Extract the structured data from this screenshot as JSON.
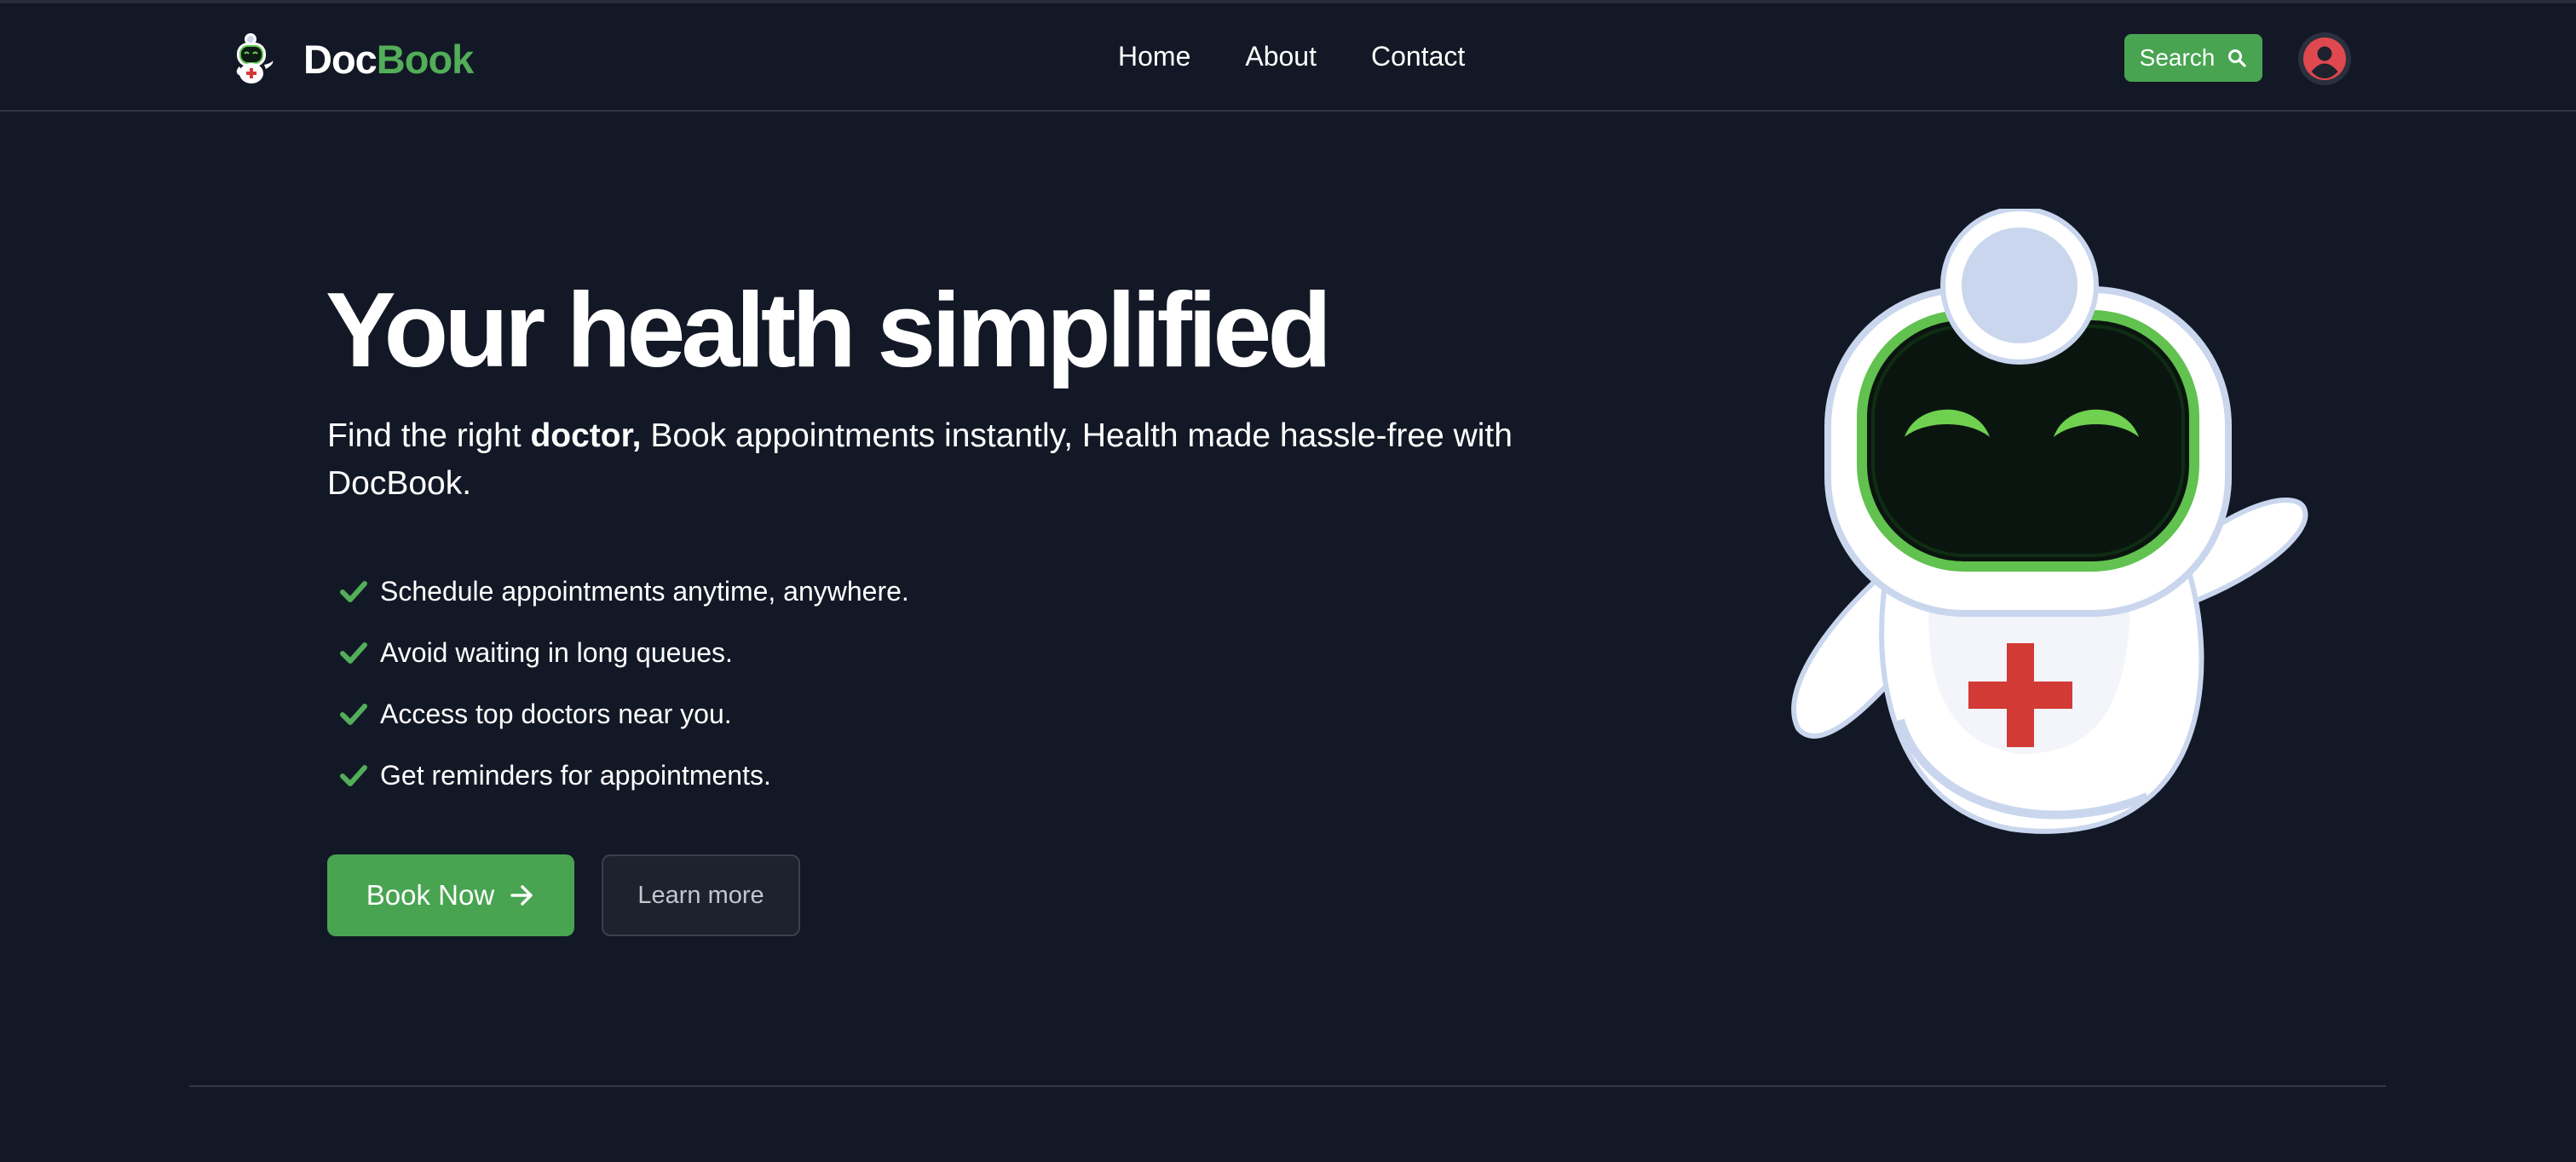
{
  "brand": {
    "name_part1": "Doc",
    "name_part2": "Book",
    "logo_icon": "robot-doctor-logo-icon"
  },
  "nav": {
    "links": [
      "Home",
      "About",
      "Contact"
    ]
  },
  "search": {
    "label": "Search",
    "icon": "search-icon"
  },
  "account": {
    "icon": "user-avatar-icon"
  },
  "hero": {
    "title": "Your health simplified",
    "subtitle_before": "Find the right ",
    "subtitle_bold": "doctor,",
    "subtitle_after": " Book appointments instantly, Health made hassle-free with DocBook.",
    "features": [
      "Schedule appointments anytime, anywhere.",
      "Avoid waiting in long queues.",
      "Access top doctors near you.",
      "Get reminders for appointments."
    ],
    "primary_button": "Book Now",
    "secondary_button": "Learn more",
    "illustration": "robot-doctor-mascot"
  },
  "colors": {
    "background": "#131826",
    "accent_green": "#48a451",
    "brand_green": "#52ae58",
    "avatar_red": "#e0484f",
    "cross_red": "#d23a36"
  }
}
